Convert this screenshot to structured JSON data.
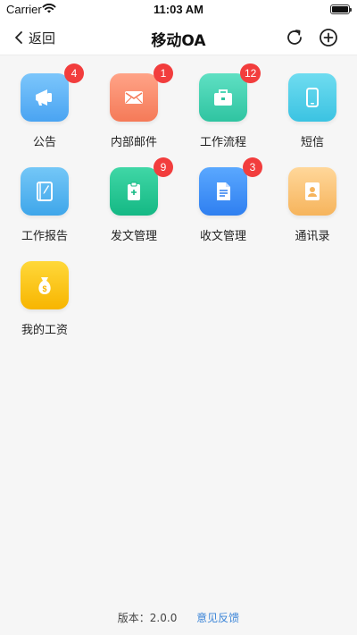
{
  "status_bar": {
    "carrier": "Carrier",
    "time": "11:03 AM"
  },
  "nav": {
    "back_label": "返回",
    "title": "移动OA"
  },
  "apps": [
    {
      "label": "公告",
      "badge": "4"
    },
    {
      "label": "内部邮件",
      "badge": "1"
    },
    {
      "label": "工作流程",
      "badge": "12"
    },
    {
      "label": "短信",
      "badge": ""
    },
    {
      "label": "工作报告",
      "badge": ""
    },
    {
      "label": "发文管理",
      "badge": "9"
    },
    {
      "label": "收文管理",
      "badge": "3"
    },
    {
      "label": "通讯录",
      "badge": ""
    },
    {
      "label": "我的工资",
      "badge": ""
    }
  ],
  "footer": {
    "version_label": "版本：2.0.0",
    "feedback_label": "意见反馈"
  },
  "colors": {
    "badge": "#f23d3d",
    "link": "#3d86d8"
  }
}
